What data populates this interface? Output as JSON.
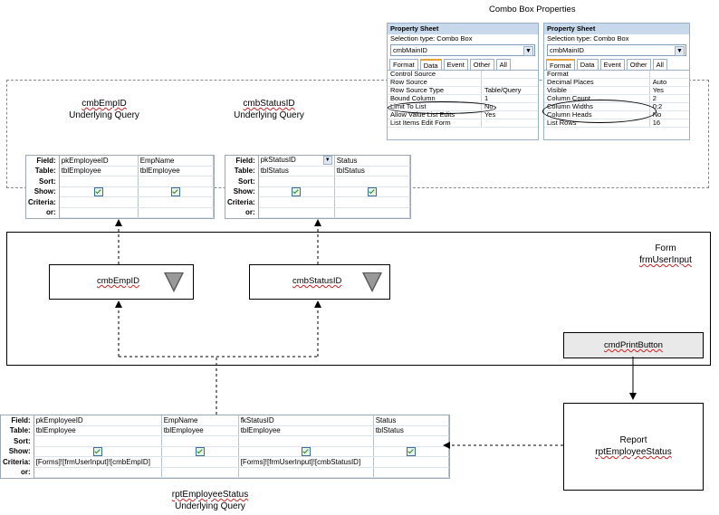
{
  "top_title": "Combo Box Properties",
  "cmbEmpID_query": {
    "caption_line1": "cmbEmpID",
    "caption_line2": "Underlying Query",
    "row_labels": [
      "Field:",
      "Table:",
      "Sort:",
      "Show:",
      "Criteria:",
      "or:"
    ],
    "columns": [
      {
        "field": "pkEmployeeID",
        "table": "tblEmployee",
        "show": true,
        "criteria": ""
      },
      {
        "field": "EmpName",
        "table": "tblEmployee",
        "show": true,
        "criteria": ""
      }
    ]
  },
  "cmbStatusID_query": {
    "caption_line1": "cmbStatusID",
    "caption_line2": "Underlying Query",
    "row_labels": [
      "Field:",
      "Table:",
      "Sort:",
      "Show:",
      "Criteria:",
      "or:"
    ],
    "columns": [
      {
        "field": "pkStatusID",
        "table": "tblStatus",
        "show": true,
        "criteria": ""
      },
      {
        "field": "Status",
        "table": "tblStatus",
        "show": true,
        "criteria": ""
      }
    ]
  },
  "property_sheet_data": {
    "title": "Property Sheet",
    "selection_type": "Selection type:  Combo Box",
    "selected_object": "cmbMainID",
    "tabs": [
      "Format",
      "Data",
      "Event",
      "Other",
      "All"
    ],
    "active_tab": "Data",
    "rows": [
      [
        "Control Source",
        ""
      ],
      [
        "Row Source",
        ""
      ],
      [
        "Row Source Type",
        "Table/Query"
      ],
      [
        "Bound Column",
        "1"
      ],
      [
        "Limit To List",
        "No"
      ],
      [
        "Allow Value List Edits",
        "Yes"
      ],
      [
        "List Items Edit Form",
        ""
      ]
    ]
  },
  "property_sheet_format": {
    "title": "Property Sheet",
    "selection_type": "Selection type:  Combo Box",
    "selected_object": "cmbMainID",
    "tabs": [
      "Format",
      "Data",
      "Event",
      "Other",
      "All"
    ],
    "active_tab": "Format",
    "rows": [
      [
        "Format",
        ""
      ],
      [
        "Decimal Places",
        "Auto"
      ],
      [
        "Visible",
        "Yes"
      ],
      [
        "Column Count",
        "2"
      ],
      [
        "Column Widths",
        "0;2"
      ],
      [
        "Column Heads",
        "No"
      ],
      [
        "List Rows",
        "16"
      ]
    ]
  },
  "form": {
    "caption_line1": "Form",
    "caption_line2": "frmUserInput",
    "combo_emp_label": "cmbEmpID",
    "combo_status_label": "cmbStatusID",
    "print_button_label": "cmdPrintButton"
  },
  "report": {
    "caption_line1": "Report",
    "caption_line2": "rptEmployeeStatus"
  },
  "report_query": {
    "caption_line1": "rptEmployeeStatus",
    "caption_line2": "Underlying Query",
    "row_labels": [
      "Field:",
      "Table:",
      "Sort:",
      "Show:",
      "Criteria:",
      "or:"
    ],
    "columns": [
      {
        "field": "pkEmployeeID",
        "table": "tblEmployee",
        "show": true,
        "criteria": "[Forms]![frmUserInput]![cmbEmpID]"
      },
      {
        "field": "EmpName",
        "table": "tblEmployee",
        "show": true,
        "criteria": ""
      },
      {
        "field": "fkStatusID",
        "table": "tblEmployee",
        "show": true,
        "criteria": "[Forms]![frmUserInput]![cmbStatusID]"
      },
      {
        "field": "Status",
        "table": "tblStatus",
        "show": true,
        "criteria": ""
      }
    ]
  }
}
